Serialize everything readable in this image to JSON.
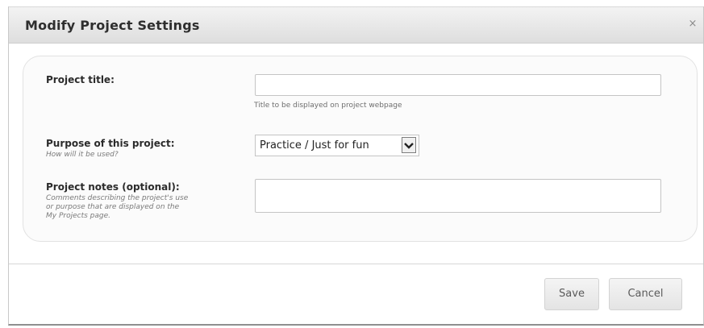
{
  "dialog": {
    "title": "Modify Project Settings",
    "close_glyph": "×"
  },
  "form": {
    "project_title": {
      "label": "Project title:",
      "value": "",
      "help": "Title to be displayed on project webpage"
    },
    "purpose": {
      "label": "Purpose of this project:",
      "hint": "How will it be used?",
      "selected": "Practice / Just for fun"
    },
    "notes": {
      "label": "Project notes (optional):",
      "hint_lines": [
        "Comments describing the project's use",
        "or purpose that are displayed on the",
        "My Projects page."
      ],
      "value": ""
    }
  },
  "buttons": {
    "save": "Save",
    "cancel": "Cancel"
  }
}
